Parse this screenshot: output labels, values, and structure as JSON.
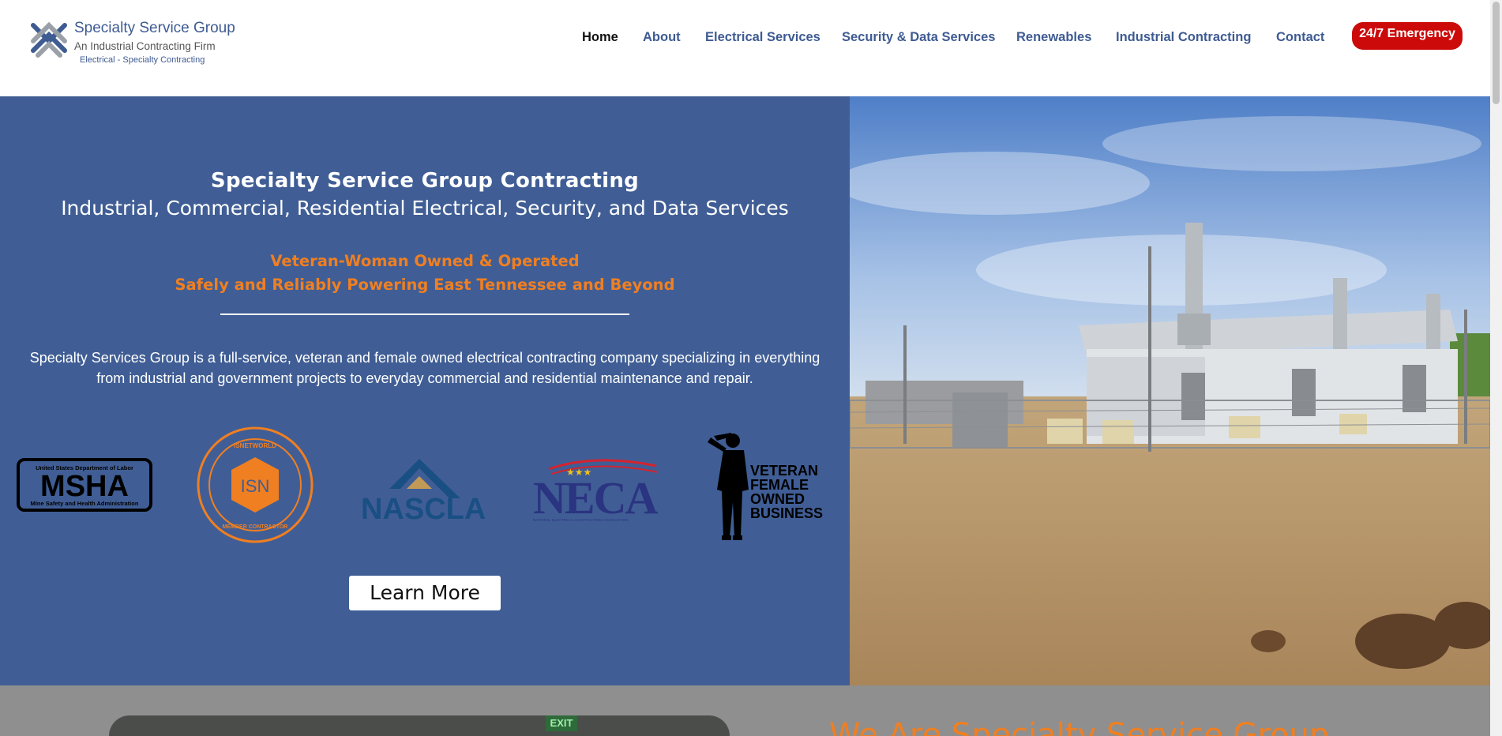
{
  "header": {
    "logo": {
      "title": "Specialty Service Group",
      "subtitle": "An Industrial Contracting Firm",
      "tagline": "Electrical - Specialty Contracting"
    },
    "nav": [
      {
        "label": "Home",
        "active": true
      },
      {
        "label": "About",
        "active": false
      },
      {
        "label": "Electrical Services",
        "active": false
      },
      {
        "label": "Security & Data Services",
        "active": false
      },
      {
        "label": "Renewables",
        "active": false
      },
      {
        "label": "Industrial Contracting",
        "active": false
      },
      {
        "label": "Contact",
        "active": false
      }
    ],
    "emergency_label": "24/7 Emergency"
  },
  "hero": {
    "title": "Specialty Service Group Contracting",
    "subtitle": "Industrial, Commercial, Residential Electrical, Security, and Data Services",
    "tagline_1": "Veteran-Woman Owned & Operated",
    "tagline_2": "Safely and Reliably Powering East Tennessee and Beyond",
    "description": "Specialty Services Group is a full-service, veteran and female owned electrical contracting company specializing in everything from industrial and government projects to everyday commercial and residential maintenance and repair.",
    "badges": {
      "msha": {
        "top": "United States Department of Labor",
        "main": "MSHA",
        "bottom": "Mine Safety and Health Administration"
      },
      "isn": {
        "top": "ISNETWORLD",
        "main": "ISN",
        "bottom": "MEMBER CONTRACTOR"
      },
      "nascla": {
        "main": "NASCLA"
      },
      "neca": {
        "main": "NECA",
        "bottom": "NATIONAL ELECTRICAL CONTRACTORS ASSOCIATION"
      },
      "vfob": {
        "line1": "VETERAN",
        "line2": "FEMALE",
        "line3": "OWNED",
        "line4": "BUSINESS"
      }
    },
    "learn_more_label": "Learn More"
  },
  "next_section": {
    "heading": "We Are Specialty Service Group",
    "exit_sign": "EXIT"
  },
  "colors": {
    "brand_blue": "#405e95",
    "accent_orange": "#f07f21",
    "emergency_red": "#cc0a0a",
    "nav_blue": "#3e5b92"
  }
}
